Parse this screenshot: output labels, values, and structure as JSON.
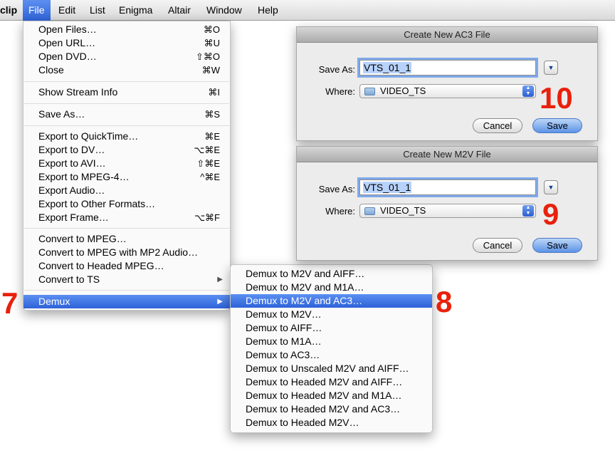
{
  "menubar": {
    "items": [
      {
        "label": "clip"
      },
      {
        "label": "File"
      },
      {
        "label": "Edit"
      },
      {
        "label": "List"
      },
      {
        "label": "Enigma"
      },
      {
        "label": "Altair"
      },
      {
        "label": "Window"
      },
      {
        "label": "Help"
      }
    ]
  },
  "file_menu": {
    "items": [
      {
        "label": "Open Files…",
        "shortcut": "⌘O"
      },
      {
        "label": "Open URL…",
        "shortcut": "⌘U"
      },
      {
        "label": "Open DVD…",
        "shortcut": "⇧⌘O"
      },
      {
        "label": "Close",
        "shortcut": "⌘W"
      },
      {
        "label": "Show Stream Info",
        "shortcut": "⌘I"
      },
      {
        "label": "Save As…",
        "shortcut": "⌘S"
      },
      {
        "label": "Export to QuickTime…",
        "shortcut": "⌘E"
      },
      {
        "label": "Export to DV…",
        "shortcut": "⌥⌘E"
      },
      {
        "label": "Export to AVI…",
        "shortcut": "⇧⌘E"
      },
      {
        "label": "Export to MPEG-4…",
        "shortcut": "^⌘E"
      },
      {
        "label": "Export Audio…",
        "shortcut": ""
      },
      {
        "label": "Export to Other Formats…",
        "shortcut": ""
      },
      {
        "label": "Export Frame…",
        "shortcut": "⌥⌘F"
      },
      {
        "label": "Convert to MPEG…",
        "shortcut": ""
      },
      {
        "label": "Convert to MPEG with MP2 Audio…",
        "shortcut": ""
      },
      {
        "label": "Convert to Headed MPEG…",
        "shortcut": ""
      },
      {
        "label": "Convert to TS",
        "shortcut": ""
      },
      {
        "label": "Demux",
        "shortcut": ""
      }
    ]
  },
  "demux_submenu": {
    "items": [
      {
        "label": "Demux to M2V and AIFF…"
      },
      {
        "label": "Demux to M2V and M1A…"
      },
      {
        "label": "Demux to M2V and AC3…"
      },
      {
        "label": "Demux to M2V…"
      },
      {
        "label": "Demux to AIFF…"
      },
      {
        "label": "Demux to M1A…"
      },
      {
        "label": "Demux to AC3…"
      },
      {
        "label": "Demux to Unscaled M2V and AIFF…"
      },
      {
        "label": "Demux to Headed M2V and AIFF…"
      },
      {
        "label": "Demux to Headed M2V and M1A…"
      },
      {
        "label": "Demux to Headed M2V and AC3…"
      },
      {
        "label": "Demux to Headed M2V…"
      }
    ]
  },
  "dialog_ac3": {
    "title": "Create New AC3 File",
    "save_as_label": "Save As:",
    "save_as_value": "VTS_01_1",
    "where_label": "Where:",
    "where_value": "VIDEO_TS",
    "cancel_label": "Cancel",
    "save_label": "Save"
  },
  "dialog_m2v": {
    "title": "Create New M2V File",
    "save_as_label": "Save As:",
    "save_as_value": "VTS_01_1",
    "where_label": "Where:",
    "where_value": "VIDEO_TS",
    "cancel_label": "Cancel",
    "save_label": "Save"
  },
  "steps": {
    "s7": "7",
    "s8": "8",
    "s9": "9",
    "s10": "10"
  },
  "colors": {
    "highlight": "#2e62d8",
    "step_annotation": "#e8210c"
  }
}
